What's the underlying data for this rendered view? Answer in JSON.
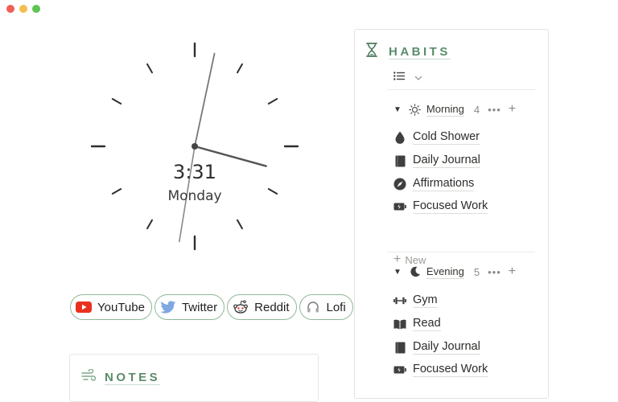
{
  "window": {
    "controls": [
      {
        "name": "close",
        "color": "#ee5f57"
      },
      {
        "name": "minimize",
        "color": "#f5bd4f"
      },
      {
        "name": "maximize",
        "color": "#5fc454"
      }
    ]
  },
  "clock": {
    "time": "3:31",
    "day": "Monday",
    "hour": 3,
    "minute": 31,
    "second": 32,
    "color": "#4a4a4a"
  },
  "links": [
    {
      "label": "YouTube",
      "icon": "youtube-icon"
    },
    {
      "label": "Twitter",
      "icon": "twitter-icon"
    },
    {
      "label": "Reddit",
      "icon": "reddit-icon"
    },
    {
      "label": "Lofi",
      "icon": "headphones-icon"
    }
  ],
  "notes": {
    "title": "NOTES",
    "icon": "wind-icon"
  },
  "habits": {
    "title": "HABITS",
    "icon": "hourglass-icon",
    "accent": "#5b8c6a",
    "view_icons": [
      "list-icon",
      "chevron-down-icon"
    ],
    "groups": [
      {
        "name": "Morning",
        "count": "4",
        "icon": "sun-icon",
        "more": "•••",
        "add": "+",
        "items": [
          {
            "label": "Cold Shower",
            "icon": "drop-icon"
          },
          {
            "label": "Daily Journal",
            "icon": "book-icon"
          },
          {
            "label": "Affirmations",
            "icon": "compass-icon"
          },
          {
            "label": "Focused Work",
            "icon": "battery-icon"
          }
        ],
        "new_label": "New"
      },
      {
        "name": "Evening",
        "count": "5",
        "icon": "moon-icon",
        "more": "•••",
        "add": "+",
        "items": [
          {
            "label": "Gym",
            "icon": "dumbbell-icon"
          },
          {
            "label": "Read",
            "icon": "open-book-icon"
          },
          {
            "label": "Daily Journal",
            "icon": "book-icon"
          },
          {
            "label": "Focused Work",
            "icon": "battery-icon"
          }
        ]
      }
    ]
  }
}
